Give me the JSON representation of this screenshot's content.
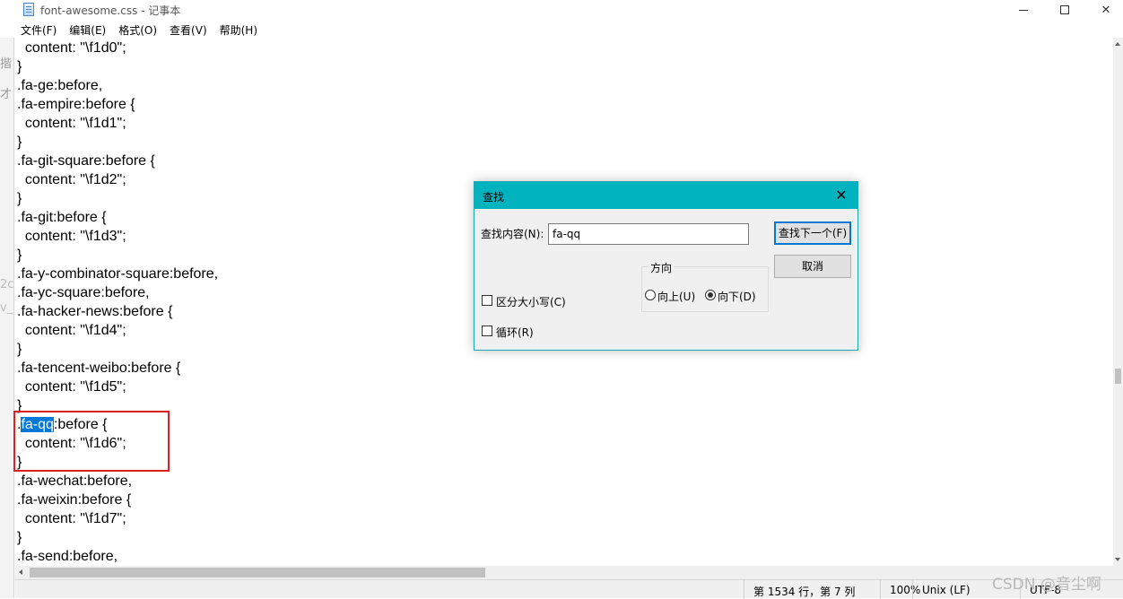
{
  "window": {
    "title": "font-awesome.css - 记事本",
    "min_symbol": "–",
    "close_symbol": "✕"
  },
  "menu": [
    "文件(F)",
    "编辑(E)",
    "格式(O)",
    "查看(V)",
    "帮助(H)"
  ],
  "left_strip_fragments": [
    "揩",
    "才",
    "2c",
    "v_"
  ],
  "code_lines": [
    "  content: \"\\f1d0\";",
    "}",
    ".fa-ge:before,",
    ".fa-empire:before {",
    "  content: \"\\f1d1\";",
    "}",
    ".fa-git-square:before {",
    "  content: \"\\f1d2\";",
    "}",
    ".fa-git:before {",
    "  content: \"\\f1d3\";",
    "}",
    ".fa-y-combinator-square:before,",
    ".fa-yc-square:before,",
    ".fa-hacker-news:before {",
    "  content: \"\\f1d4\";",
    "}",
    ".fa-tencent-weibo:before {",
    "  content: \"\\f1d5\";",
    "}",
    ".fa-qq:before {",
    "  content: \"\\f1d6\";",
    "}",
    ".fa-wechat:before,",
    ".fa-weixin:before {",
    "  content: \"\\f1d7\";",
    "}",
    ".fa-send:before,"
  ],
  "selected_line": {
    "prefix": ".",
    "selected": "fa-qq",
    "suffix": ":before {"
  },
  "status": {
    "position": "第 1534 行，第 7 列",
    "zoom": "100%",
    "line_ending": "Unix (LF)",
    "encoding": "UTF-8"
  },
  "watermark": "CSDN @音尘啊",
  "find_dialog": {
    "title": "查找",
    "find_label": "查找内容(N):",
    "find_value": "fa-qq",
    "find_next_button": "查找下一个(F)",
    "cancel_button": "取消",
    "direction_label": "方向",
    "up_label": "向上(U)",
    "down_label": "向下(D)",
    "match_case_label": "区分大小写(C)",
    "wrap_label": "循环(R)",
    "direction": "down",
    "match_case": false,
    "wrap": false
  },
  "colors": {
    "dialog_title": "#00b3bf",
    "selection": "#0078d7",
    "highlight_box": "#e02020"
  }
}
